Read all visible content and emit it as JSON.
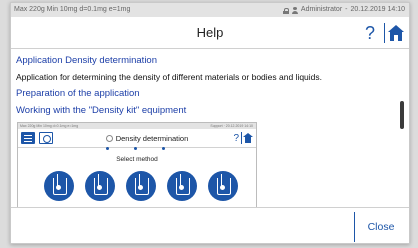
{
  "status_bar": {
    "left_text": "Max 220g Min 10mg d=0.1mg e=1mg",
    "user": "Administrator",
    "datetime": "20.12.2019 14:10"
  },
  "header": {
    "title": "Help",
    "help_label": "?"
  },
  "content": {
    "heading": "Application Density determination",
    "description": "Application for determining the density of different materials or bodies and liquids.",
    "link_preparation": "Preparation of the application",
    "link_working": "Working with the \"Density kit\" equipment",
    "embedded_screenshot": {
      "status_left": "Max 220g Min 10mg d=0.1mg e=1mg",
      "status_right": "Support · 20.12.2019 14:10",
      "title": "Density determination",
      "help_label": "?",
      "prompt": "Select method",
      "method_count": 5
    }
  },
  "footer": {
    "close_label": "Close"
  },
  "colors": {
    "accent": "#1d56a8",
    "link": "#1d3fa8"
  }
}
